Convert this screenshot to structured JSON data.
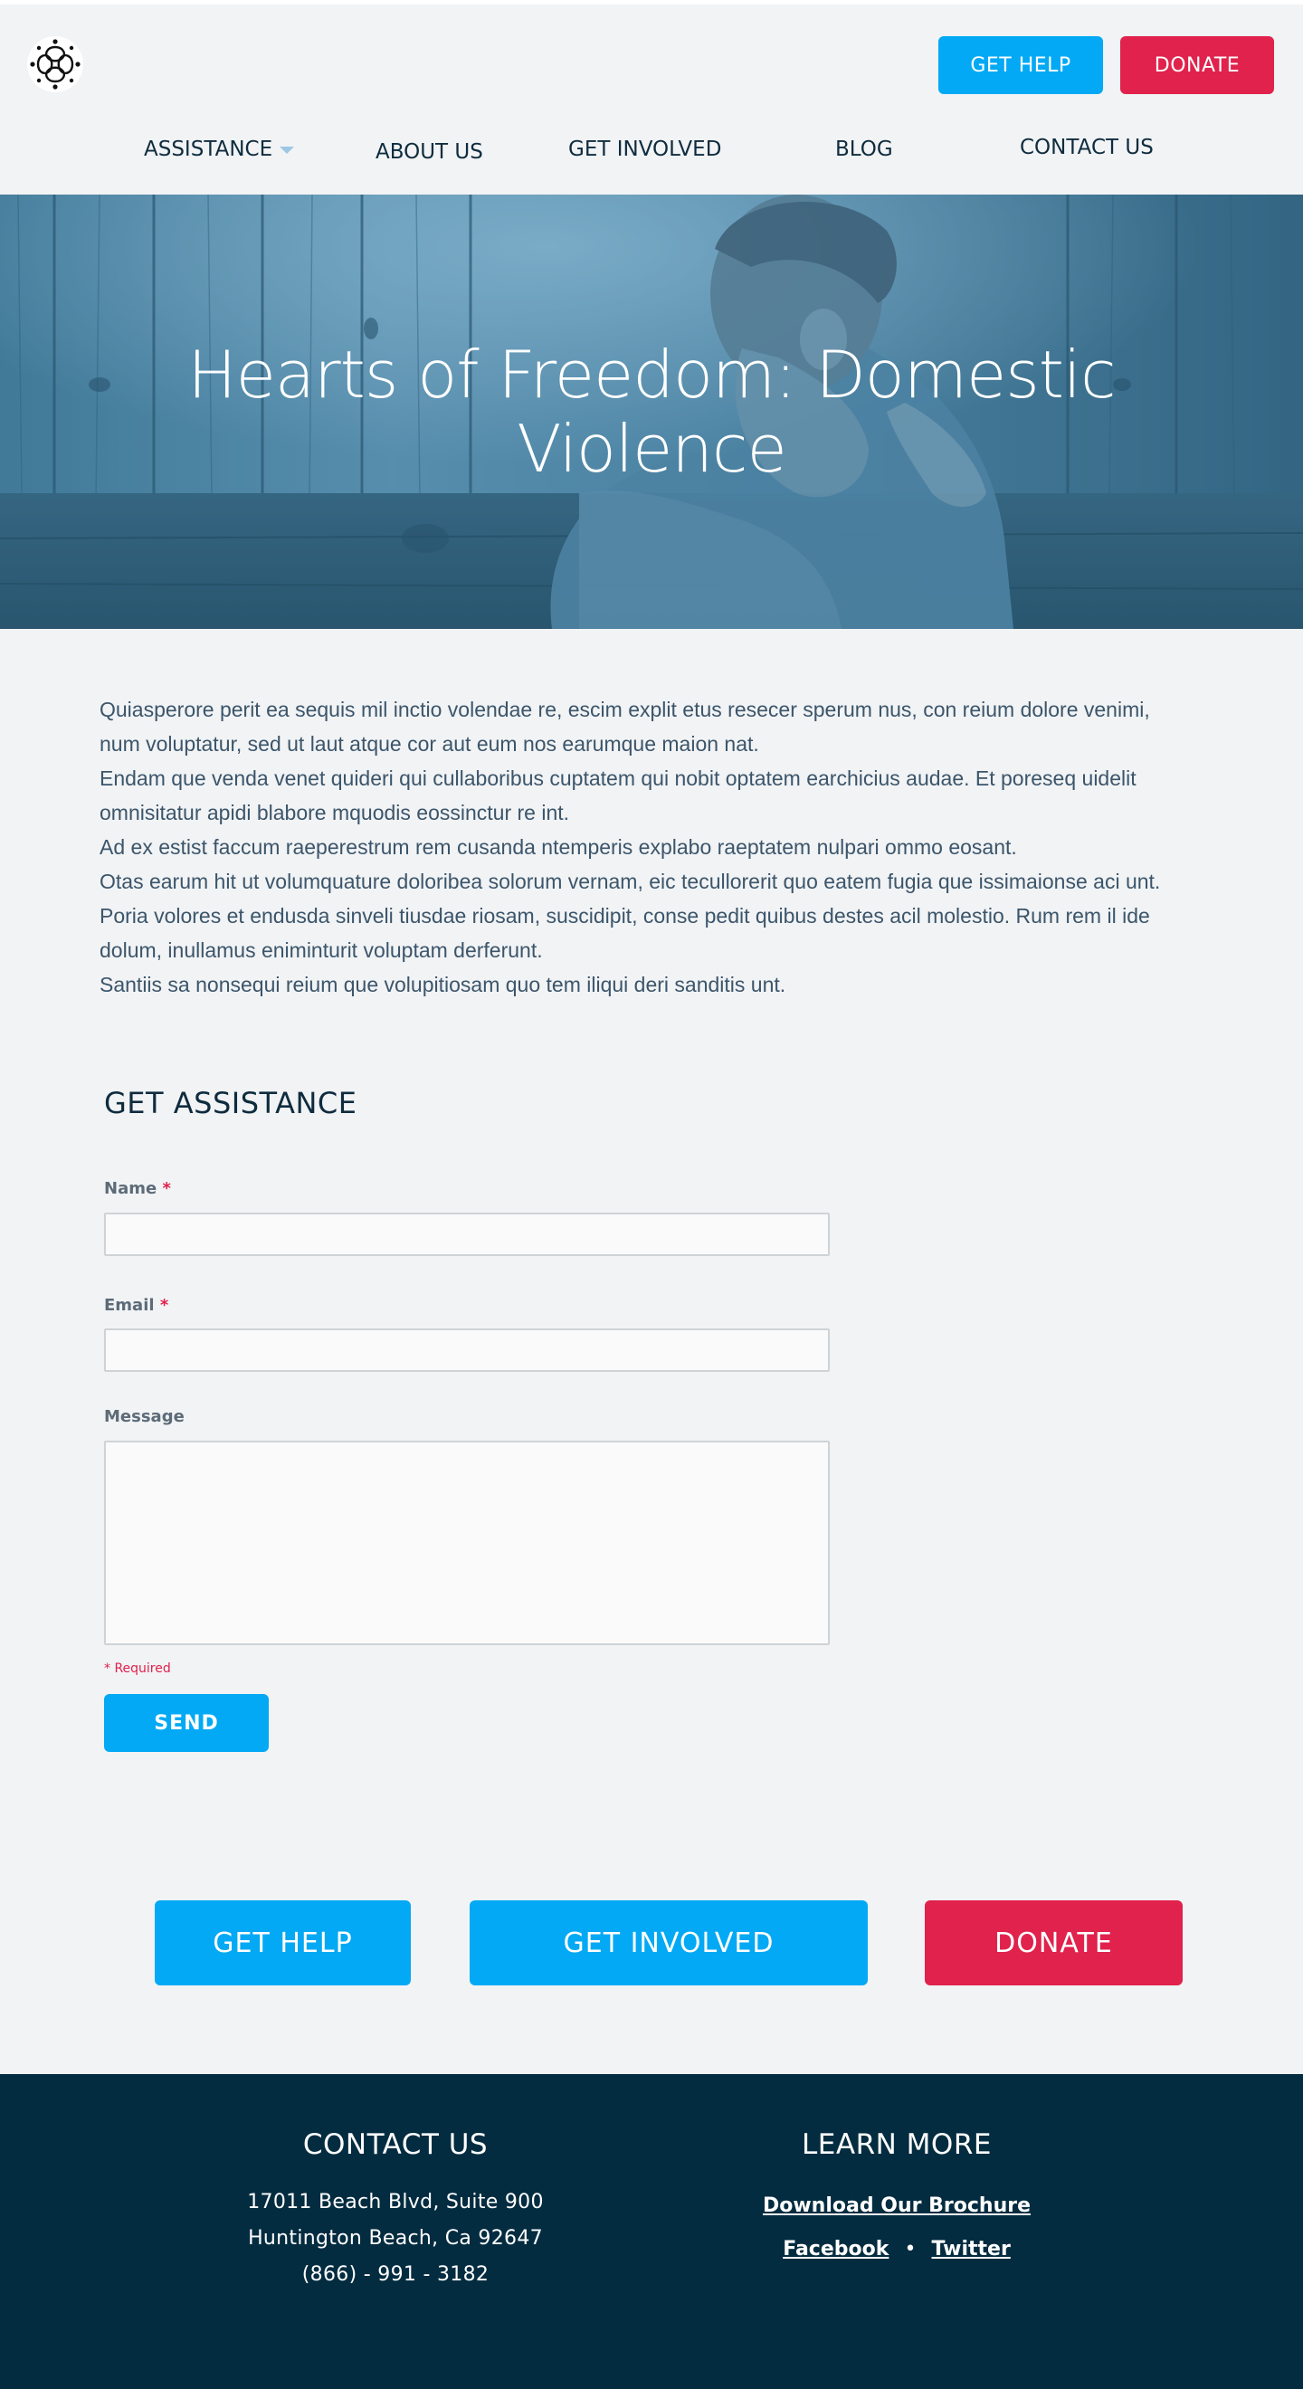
{
  "header": {
    "logo_icon": "circular-knot-logo-icon",
    "get_help_label": "GET HELP",
    "donate_label": "DONATE"
  },
  "nav": {
    "items": [
      {
        "label": "ASSISTANCE",
        "has_dropdown": true
      },
      {
        "label": "ABOUT US",
        "has_dropdown": false
      },
      {
        "label": "GET INVOLVED",
        "has_dropdown": false
      },
      {
        "label": "BLOG",
        "has_dropdown": false
      },
      {
        "label": "CONTACT US",
        "has_dropdown": false
      }
    ]
  },
  "hero": {
    "title": "Hearts of Freedom: Domestic Violence"
  },
  "intro": {
    "paragraphs": [
      "Quiasperore perit ea sequis mil inctio volendae re, escim explit etus resecer sperum nus, con reium dolore venimi, num voluptatur, sed ut laut atque cor aut eum nos earumque maion nat.",
      "Endam que venda venet quideri qui cullaboribus cuptatem qui nobit optatem earchicius audae. Et poreseq uidelit omnisitatur apidi blabore mquodis eossinctur re int.",
      "Ad ex estist faccum raeperestrum rem cusanda ntemperis explabo raeptatem nulpari ommo eosant.",
      "Otas earum hit ut volumquature doloribea solorum vernam, eic tecullorerit quo eatem fugia que issimaionse aci unt.",
      "Poria volores et endusda sinveli tiusdae riosam, suscidipit, conse pedit quibus destes acil molestio. Rum rem il ide dolum, inullamus eniminturit voluptam derferunt.",
      "Santiis sa nonsequi reium que volupitiosam quo tem iliqui deri sanditis unt."
    ]
  },
  "form": {
    "title": "GET ASSISTANCE",
    "name_label": "Name",
    "email_label": "Email",
    "message_label": "Message",
    "required_mark": "*",
    "name_value": "",
    "email_value": "",
    "message_value": "",
    "required_note": "* Required",
    "send_label": "SEND"
  },
  "cta": {
    "get_help_label": "GET HELP",
    "get_involved_label": "GET INVOLVED",
    "donate_label": "DONATE"
  },
  "footer": {
    "contact_title": "CONTACT US",
    "address_line1": "17011 Beach Blvd, Suite 900",
    "address_line2": "Huntington Beach, Ca 92647",
    "phone": "(866) - 991 - 3182",
    "learn_title": "LEARN MORE",
    "brochure_link": "Download Our Brochure",
    "facebook_link": "Facebook",
    "separator": "•",
    "twitter_link": "Twitter"
  },
  "colors": {
    "primary_blue": "#03a9f4",
    "donate_red": "#e0224c",
    "navy": "#0f2c3e",
    "footer_bg": "#042c40",
    "page_bg": "#f1f3f5"
  }
}
